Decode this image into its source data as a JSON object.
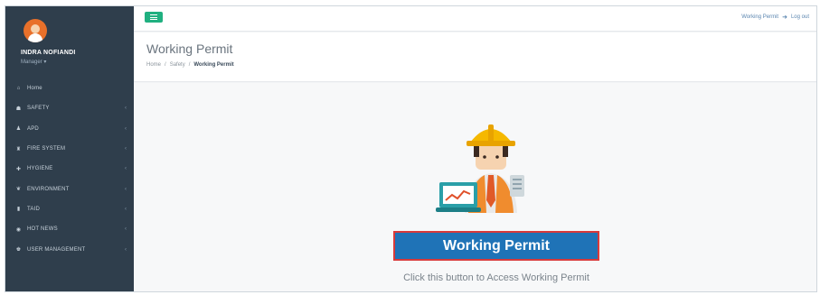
{
  "profile": {
    "name": "INDRA NOFIANDI",
    "role": "Manager ▾"
  },
  "sidebar": {
    "items": [
      {
        "label": "Home",
        "icon": "home-icon",
        "glyph": "⌂",
        "has_children": false
      },
      {
        "label": "SAFETY",
        "icon": "thumbs-up-icon",
        "glyph": "☗",
        "has_children": true
      },
      {
        "label": "APD",
        "icon": "user-icon",
        "glyph": "♟",
        "has_children": true
      },
      {
        "label": "FIRE SYSTEM",
        "icon": "fire-extinguisher-icon",
        "glyph": "♜",
        "has_children": true
      },
      {
        "label": "HYGIENE",
        "icon": "wrench-icon",
        "glyph": "✚",
        "has_children": true
      },
      {
        "label": "ENVIRONMENT",
        "icon": "leaf-icon",
        "glyph": "❦",
        "has_children": true
      },
      {
        "label": "TAID",
        "icon": "bar-chart-icon",
        "glyph": "▮",
        "has_children": true
      },
      {
        "label": "HOT NEWS",
        "icon": "eye-icon",
        "glyph": "◉",
        "has_children": true
      },
      {
        "label": "USER MANAGEMENT",
        "icon": "users-icon",
        "glyph": "♚",
        "has_children": true
      }
    ],
    "chevron": "‹"
  },
  "topbar": {
    "right_link": "Working Permit",
    "logout_glyph": "➜",
    "logout_label": "Log out"
  },
  "page": {
    "title": "Working Permit",
    "breadcrumb": [
      "Home",
      "/",
      "Safety",
      "/",
      "Working Permit"
    ]
  },
  "content": {
    "button_label": "Working Permit",
    "helper_text": "Click this button to Access Working Permit"
  },
  "colors": {
    "sidebar_bg": "#2f3e4c",
    "accent_green": "#20b080",
    "button_blue": "#1f73b7",
    "button_border_red": "#d93a3a"
  }
}
